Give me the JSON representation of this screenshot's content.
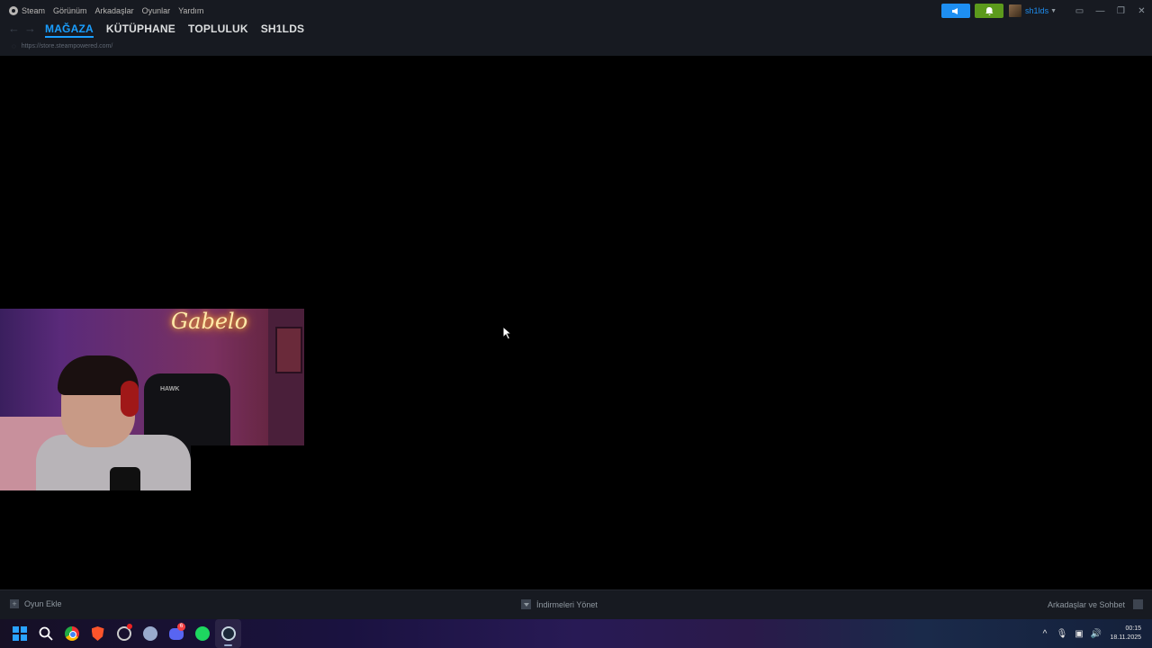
{
  "menubar": {
    "items": [
      "Steam",
      "Görünüm",
      "Arkadaşlar",
      "Oyunlar",
      "Yardım"
    ]
  },
  "account": {
    "username": "sh1lds"
  },
  "nav": {
    "tabs": [
      "MAĞAZA",
      "KÜTÜPHANE",
      "TOPLULUK",
      "SH1LDS"
    ],
    "active_tab": "MAĞAZA",
    "url": "https://store.steampowered.com/"
  },
  "webcam": {
    "neon_sign": "Gabelo",
    "chair_brand": "HAWK"
  },
  "bottom_bar": {
    "add_game": "Oyun Ekle",
    "manage_downloads": "İndirmeleri Yönet",
    "friends_chat": "Arkadaşlar ve Sohbet"
  },
  "taskbar": {
    "apps": [
      "windows-start",
      "search",
      "chrome",
      "brave",
      "app-circle",
      "app-gear",
      "discord",
      "spotify",
      "steam"
    ],
    "discord_badge": "6",
    "time": "00:15",
    "date": "18.11.2025"
  },
  "colors": {
    "accent": "#1a9fff",
    "steam_bg": "#171a21",
    "notif_green": "#5c9a1c",
    "announce_blue": "#1e8ff2"
  }
}
